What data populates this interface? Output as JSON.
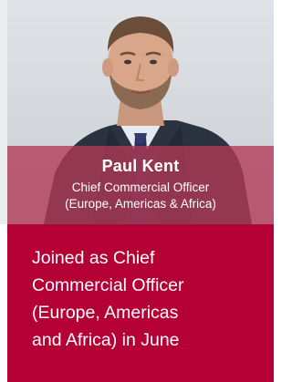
{
  "profile": {
    "name": "Paul Kent",
    "role_line_1": "Chief Commercial Officer",
    "role_line_2": "(Europe, Americas & Africa)",
    "photo_description_icon": "person-portrait-icon"
  },
  "note": {
    "line_1": "Joined as Chief",
    "line_2": "Commercial Officer",
    "line_3": "(Europe, Americas",
    "line_4": "and Africa) in June"
  },
  "colors": {
    "caption_band": "#b23854",
    "note_background": "#b40034",
    "text": "#ffffff"
  }
}
